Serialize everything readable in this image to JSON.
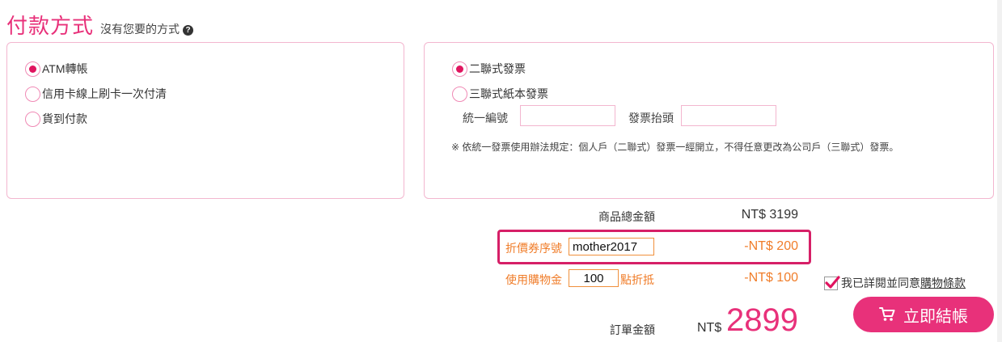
{
  "header": {
    "title": "付款方式",
    "subtitle": "沒有您要的方式",
    "help_icon": "?"
  },
  "payment": {
    "options": [
      {
        "label": "ATM轉帳",
        "checked": true
      },
      {
        "label": "信用卡線上刷卡一次付清",
        "checked": false
      },
      {
        "label": "貨到付款",
        "checked": false
      }
    ]
  },
  "invoice": {
    "options": [
      {
        "label": "二聯式發票",
        "checked": true
      },
      {
        "label": "三聯式紙本發票",
        "checked": false
      }
    ],
    "tax_id_label": "統一編號",
    "tax_id_value": "",
    "title_label": "發票抬頭",
    "title_value": "",
    "note": "※ 依統一發票使用辦法規定：個人戶（二聯式）發票一經開立，不得任意更改為公司戶（三聯式）發票。"
  },
  "summary": {
    "subtotal_label": "商品總金額",
    "subtotal_value": "NT$ 3199",
    "coupon_label": "折價券序號",
    "coupon_code": "mother2017",
    "coupon_discount": "-NT$ 200",
    "points_label_prefix": "使用購物金",
    "points_value": "100",
    "points_label_suffix": "點折抵",
    "points_discount": "-NT$ 100",
    "total_label": "訂單金額",
    "total_currency": "NT$",
    "total_value": "2899"
  },
  "agreement": {
    "checked": true,
    "text": "我已詳閱並同意",
    "link": "購物條款"
  },
  "checkout": {
    "label": "立即結帳",
    "icon": "cart-icon"
  },
  "colors": {
    "accent": "#e8317a",
    "orange": "#f07d2a",
    "border": "#f3b6cf"
  }
}
